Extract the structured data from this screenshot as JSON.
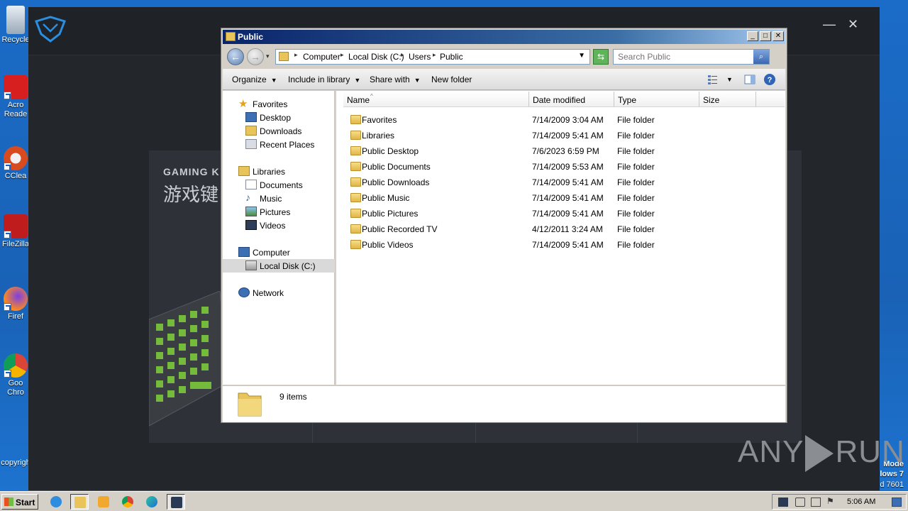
{
  "desktop": {
    "icons": [
      {
        "label": "Recycle",
        "name": "recycle-bin"
      },
      {
        "label": "Acro Reade",
        "name": "acrobat-reader"
      },
      {
        "label": "CClea",
        "name": "ccleaner"
      },
      {
        "label": "FileZilla",
        "name": "filezilla"
      },
      {
        "label": "Firef",
        "name": "firefox"
      },
      {
        "label": "Goo Chro",
        "name": "google-chrome"
      },
      {
        "label": "copyrigh",
        "name": "copyright"
      }
    ],
    "os_lines": [
      "Mode",
      "lows 7",
      "ld 7601"
    ]
  },
  "app_window": {
    "title_en": "GAMING K",
    "title_cn": "游戏键",
    "minimize": "—",
    "close": "✕"
  },
  "watermark": {
    "left": "ANY",
    "right": "RUN"
  },
  "explorer": {
    "title": "Public",
    "address": {
      "crumbs": [
        "Computer",
        "Local Disk (C:)",
        "Users",
        "Public"
      ]
    },
    "search": {
      "placeholder": "Search Public"
    },
    "toolbar": {
      "organize": "Organize",
      "include_in_library": "Include in library",
      "share_with": "Share with",
      "new_folder": "New folder"
    },
    "nav": {
      "favorites": "Favorites",
      "desktop": "Desktop",
      "downloads": "Downloads",
      "recent_places": "Recent Places",
      "libraries": "Libraries",
      "documents": "Documents",
      "music": "Music",
      "pictures": "Pictures",
      "videos": "Videos",
      "computer": "Computer",
      "local_disk": "Local Disk (C:)",
      "network": "Network"
    },
    "columns": {
      "name": "Name",
      "date_modified": "Date modified",
      "type": "Type",
      "size": "Size"
    },
    "files": [
      {
        "name": "Favorites",
        "date": "7/14/2009 3:04 AM",
        "type": "File folder"
      },
      {
        "name": "Libraries",
        "date": "7/14/2009 5:41 AM",
        "type": "File folder"
      },
      {
        "name": "Public Desktop",
        "date": "7/6/2023 6:59 PM",
        "type": "File folder"
      },
      {
        "name": "Public Documents",
        "date": "7/14/2009 5:53 AM",
        "type": "File folder"
      },
      {
        "name": "Public Downloads",
        "date": "7/14/2009 5:41 AM",
        "type": "File folder"
      },
      {
        "name": "Public Music",
        "date": "7/14/2009 5:41 AM",
        "type": "File folder"
      },
      {
        "name": "Public Pictures",
        "date": "7/14/2009 5:41 AM",
        "type": "File folder"
      },
      {
        "name": "Public Recorded TV",
        "date": "4/12/2011 3:24 AM",
        "type": "File folder"
      },
      {
        "name": "Public Videos",
        "date": "7/14/2009 5:41 AM",
        "type": "File folder"
      }
    ],
    "status": {
      "count": "9 items"
    }
  },
  "taskbar": {
    "start": "Start",
    "clock": "5:06 AM"
  }
}
